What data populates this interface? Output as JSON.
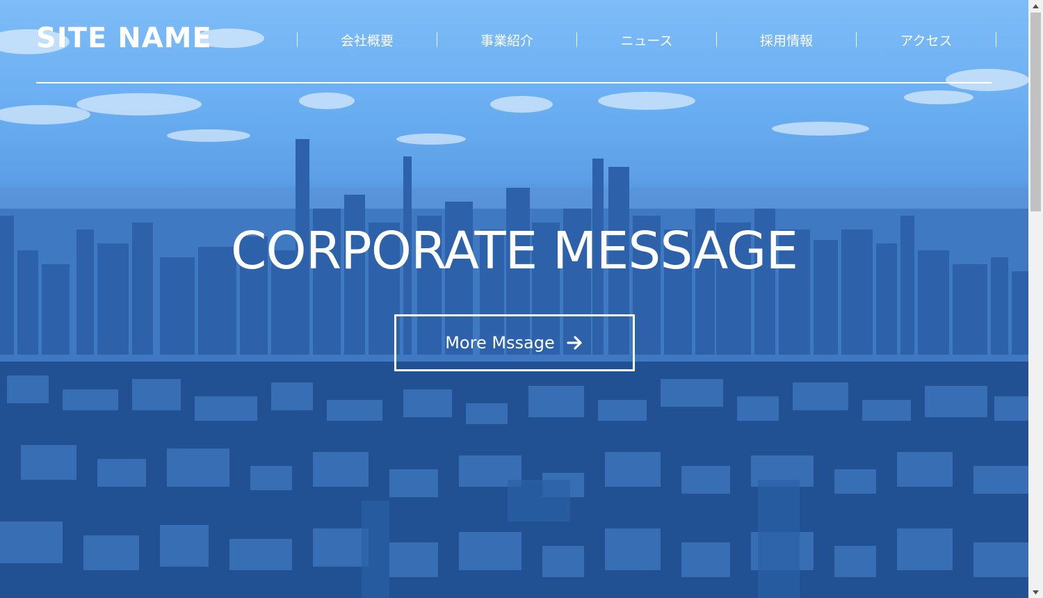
{
  "site": {
    "name": "SITE NAME"
  },
  "nav": {
    "items": [
      {
        "label": "会社概要"
      },
      {
        "label": "事業紹介"
      },
      {
        "label": "ニュース"
      },
      {
        "label": "採用情報"
      },
      {
        "label": "アクセス"
      }
    ]
  },
  "hero": {
    "title": "CORPORATE MESSAGE",
    "cta_label": "More Mssage",
    "cta_icon": "arrow-right-icon",
    "background": "city-skyline-image"
  },
  "colors": {
    "tint": "#3a78c8",
    "sky": "#7dbcf7",
    "text": "#ffffff"
  }
}
